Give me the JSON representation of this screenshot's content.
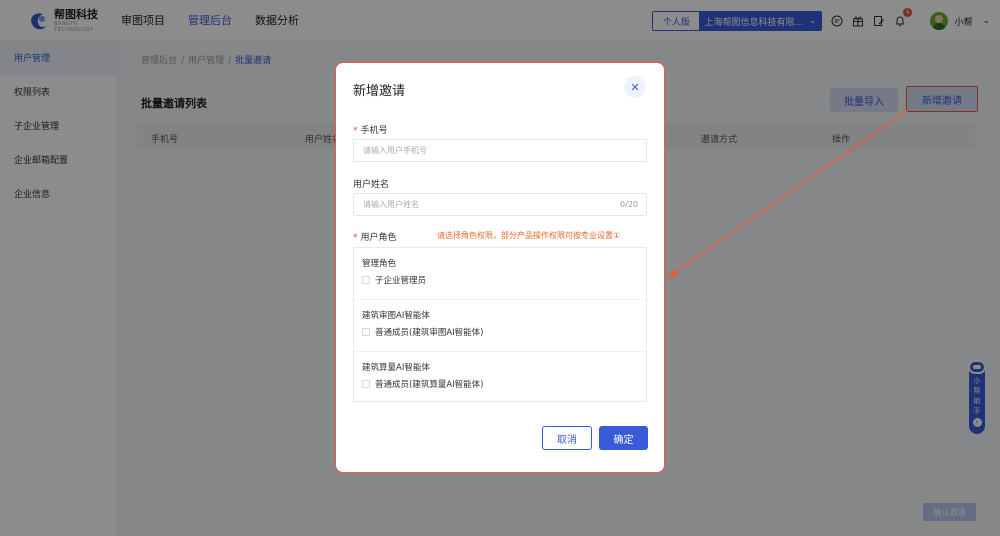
{
  "header": {
    "logo_text": "帮图科技",
    "logo_sub": "BANGTU TECHNOLOGY",
    "nav": [
      "审图项目",
      "管理后台",
      "数据分析"
    ],
    "active_nav": 1,
    "version_personal": "个人版",
    "version_company": "上海帮图信息科技有限...",
    "notification_count": "6",
    "user_name": "小帮"
  },
  "sidebar": {
    "items": [
      "用户管理",
      "权限列表",
      "子企业管理",
      "企业邮箱配置",
      "企业信息"
    ]
  },
  "main": {
    "breadcrumb": [
      "管理后台",
      "用户管理",
      "批量邀请"
    ],
    "panel_title": "批量邀请列表",
    "import_button": "批量导入",
    "new_invite_button": "新增邀请",
    "columns": [
      "手机号",
      "用户姓名",
      "邀请方式",
      "操作"
    ],
    "confirm_invite_button": "确认邀请"
  },
  "assistant": {
    "chars": [
      "小",
      "帮",
      "助",
      "手"
    ]
  },
  "dialog": {
    "title": "新增邀请",
    "phone_label": "手机号",
    "phone_placeholder": "请输入用户手机号",
    "name_label": "用户姓名",
    "name_placeholder": "请输入用户姓名",
    "name_count": "0/20",
    "role_label": "用户角色",
    "role_hint": "请选择角色权限，部分产品操作权限可按专业设置①",
    "role_groups": [
      {
        "title": "管理角色",
        "option": "子企业管理员"
      },
      {
        "title": "建筑审图AI智能体",
        "option": "普通成员(建筑审图AI智能体)"
      },
      {
        "title": "建筑算量AI智能体",
        "option": "普通成员(建筑算量AI智能体)"
      }
    ],
    "cancel_button": "取消",
    "ok_button": "确定"
  },
  "colors": {
    "primary": "#3a5bd9",
    "annotation": "#e95a3c"
  }
}
